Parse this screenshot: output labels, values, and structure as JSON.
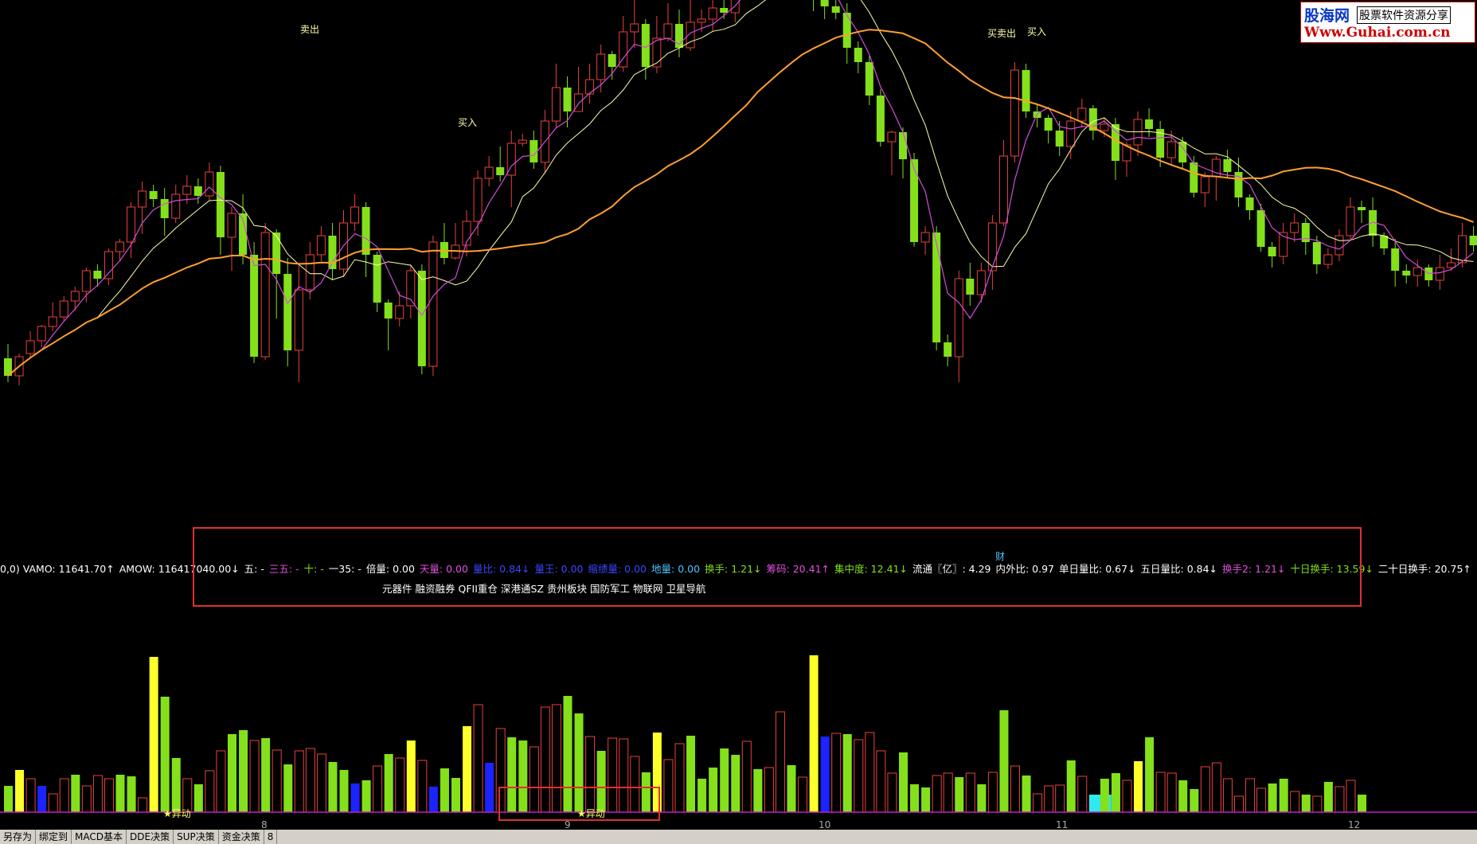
{
  "chart_data": {
    "type": "candlestick",
    "candles": [
      [
        -15,
        -26,
        -6,
        -30
      ],
      [
        -26,
        -14,
        -12,
        -32
      ],
      [
        -12,
        -4,
        2,
        -15
      ],
      [
        -4,
        5,
        6,
        -8
      ],
      [
        5,
        11,
        20,
        2
      ],
      [
        11,
        21,
        24,
        8
      ],
      [
        21,
        27,
        30,
        15
      ],
      [
        27,
        40,
        42,
        20
      ],
      [
        40,
        35,
        44,
        30
      ],
      [
        35,
        52,
        54,
        31
      ],
      [
        52,
        58,
        60,
        46
      ],
      [
        58,
        80,
        83,
        48
      ],
      [
        80,
        90,
        96,
        63
      ],
      [
        90,
        85,
        94,
        80
      ],
      [
        85,
        73,
        92,
        62
      ],
      [
        73,
        88,
        94,
        70
      ],
      [
        88,
        93,
        100,
        82
      ],
      [
        93,
        87,
        98,
        82
      ],
      [
        87,
        102,
        108,
        84
      ],
      [
        102,
        61,
        106,
        50
      ],
      [
        61,
        76,
        80,
        40
      ],
      [
        76,
        50,
        88,
        44
      ],
      [
        50,
        -14,
        58,
        -18
      ],
      [
        -14,
        64,
        70,
        -16
      ],
      [
        64,
        38,
        66,
        10
      ],
      [
        38,
        -10,
        48,
        -20
      ],
      [
        -10,
        28,
        45,
        -30
      ],
      [
        28,
        50,
        58,
        22
      ],
      [
        50,
        62,
        68,
        46
      ],
      [
        62,
        41,
        70,
        34
      ],
      [
        41,
        70,
        78,
        36
      ],
      [
        70,
        80,
        88,
        65
      ],
      [
        80,
        50,
        83,
        36
      ],
      [
        50,
        20,
        52,
        14
      ],
      [
        20,
        10,
        22,
        -10
      ],
      [
        10,
        18,
        27,
        5
      ],
      [
        18,
        40,
        44,
        10
      ],
      [
        40,
        -20,
        44,
        -25
      ],
      [
        -20,
        58,
        62,
        -26
      ],
      [
        58,
        48,
        70,
        44
      ],
      [
        48,
        56,
        70,
        47
      ],
      [
        56,
        71,
        78,
        49
      ],
      [
        71,
        98,
        103,
        62
      ],
      [
        98,
        105,
        112,
        93
      ],
      [
        105,
        100,
        118,
        96
      ],
      [
        100,
        120,
        128,
        80
      ],
      [
        120,
        122,
        126,
        118
      ],
      [
        122,
        108,
        128,
        104
      ],
      [
        108,
        134,
        141,
        101
      ],
      [
        134,
        155,
        170,
        130
      ],
      [
        155,
        140,
        162,
        130
      ],
      [
        140,
        151,
        168,
        142
      ],
      [
        151,
        160,
        170,
        145
      ],
      [
        160,
        176,
        182,
        152
      ],
      [
        176,
        168,
        178,
        160
      ],
      [
        168,
        190,
        200,
        165
      ],
      [
        190,
        195,
        210,
        180
      ],
      [
        195,
        168,
        198,
        160
      ],
      [
        168,
        186,
        200,
        164
      ],
      [
        186,
        195,
        208,
        184
      ],
      [
        195,
        180,
        204,
        174
      ],
      [
        180,
        196,
        214,
        178
      ],
      [
        196,
        198,
        204,
        190
      ],
      [
        198,
        205,
        214,
        190
      ],
      [
        205,
        202,
        212,
        198
      ],
      [
        202,
        220,
        226,
        196
      ],
      [
        220,
        232,
        238,
        214
      ],
      [
        232,
        228,
        236,
        224
      ],
      [
        228,
        243,
        250,
        225
      ],
      [
        243,
        236,
        250,
        232
      ],
      [
        236,
        229,
        240,
        222
      ],
      [
        229,
        233,
        238,
        224
      ],
      [
        233,
        213,
        236,
        203
      ],
      [
        213,
        206,
        216,
        198
      ],
      [
        206,
        202,
        210,
        198
      ],
      [
        202,
        180,
        208,
        170
      ],
      [
        180,
        171,
        184,
        164
      ],
      [
        171,
        150,
        175,
        144
      ],
      [
        150,
        121,
        154,
        118
      ],
      [
        121,
        127,
        128,
        100
      ],
      [
        127,
        110,
        130,
        98
      ],
      [
        110,
        58,
        114,
        55
      ],
      [
        58,
        64,
        68,
        50
      ],
      [
        64,
        -5,
        68,
        -10
      ],
      [
        -5,
        -14,
        0,
        -20
      ],
      [
        -14,
        35,
        40,
        -30
      ],
      [
        35,
        25,
        45,
        18
      ],
      [
        25,
        40,
        45,
        20
      ],
      [
        40,
        70,
        75,
        28
      ],
      [
        70,
        112,
        122,
        68
      ],
      [
        112,
        166,
        171,
        108
      ],
      [
        166,
        140,
        170,
        136
      ],
      [
        140,
        136,
        144,
        130
      ],
      [
        136,
        128,
        138,
        120
      ],
      [
        128,
        118,
        134,
        112
      ],
      [
        118,
        134,
        140,
        110
      ],
      [
        134,
        142,
        148,
        130
      ],
      [
        142,
        128,
        144,
        122
      ],
      [
        128,
        132,
        136,
        124
      ],
      [
        132,
        109,
        136,
        97
      ],
      [
        109,
        119,
        121,
        99
      ],
      [
        119,
        135,
        140,
        112
      ],
      [
        135,
        129,
        142,
        124
      ],
      [
        129,
        111,
        134,
        105
      ],
      [
        111,
        121,
        128,
        106
      ],
      [
        121,
        108,
        124,
        104
      ],
      [
        108,
        89,
        112,
        86
      ],
      [
        89,
        99,
        102,
        80
      ],
      [
        99,
        110,
        112,
        84
      ],
      [
        110,
        102,
        116,
        98
      ],
      [
        102,
        86,
        111,
        80
      ],
      [
        86,
        78,
        88,
        72
      ],
      [
        78,
        55,
        82,
        52
      ],
      [
        55,
        49,
        58,
        42
      ],
      [
        49,
        64,
        70,
        44
      ],
      [
        64,
        70,
        76,
        58
      ],
      [
        70,
        58,
        73,
        50
      ],
      [
        58,
        44,
        62,
        38
      ],
      [
        44,
        50,
        54,
        41
      ],
      [
        50,
        62,
        66,
        46
      ],
      [
        62,
        80,
        86,
        59
      ],
      [
        80,
        78,
        84,
        70
      ],
      [
        78,
        62,
        86,
        55
      ],
      [
        62,
        54,
        64,
        50
      ],
      [
        54,
        40,
        60,
        30
      ],
      [
        40,
        37,
        44,
        32
      ],
      [
        37,
        42,
        47,
        30
      ],
      [
        42,
        34,
        44,
        30
      ],
      [
        34,
        42,
        50,
        28
      ],
      [
        42,
        45,
        54,
        40
      ],
      [
        45,
        62,
        70,
        42
      ],
      [
        62,
        56,
        68,
        52
      ]
    ],
    "volume": [
      [
        33,
        "green"
      ],
      [
        53,
        "yellow"
      ],
      [
        42,
        "hollow"
      ],
      [
        33,
        "blue"
      ],
      [
        23,
        "hollow"
      ],
      [
        42,
        "hollow"
      ],
      [
        47,
        "green"
      ],
      [
        33,
        "hollow"
      ],
      [
        46,
        "hollow"
      ],
      [
        42,
        "hollow"
      ],
      [
        47,
        "green"
      ],
      [
        45,
        "green"
      ],
      [
        18,
        "hollow"
      ],
      [
        195,
        "yellow"
      ],
      [
        145,
        "green"
      ],
      [
        68,
        "green"
      ],
      [
        42,
        "hollow"
      ],
      [
        35,
        "green"
      ],
      [
        52,
        "hollow"
      ],
      [
        77,
        "hollow"
      ],
      [
        98,
        "green"
      ],
      [
        103,
        "green"
      ],
      [
        90,
        "hollow"
      ],
      [
        93,
        "green"
      ],
      [
        78,
        "hollow"
      ],
      [
        60,
        "green"
      ],
      [
        77,
        "hollow"
      ],
      [
        80,
        "hollow"
      ],
      [
        73,
        "hollow"
      ],
      [
        63,
        "green"
      ],
      [
        53,
        "green"
      ],
      [
        36,
        "blue"
      ],
      [
        40,
        "green"
      ],
      [
        58,
        "hollow"
      ],
      [
        73,
        "green"
      ],
      [
        68,
        "hollow"
      ],
      [
        90,
        "yellow"
      ],
      [
        65,
        "hollow"
      ],
      [
        32,
        "blue"
      ],
      [
        55,
        "green"
      ],
      [
        43,
        "green"
      ],
      [
        108,
        "yellow"
      ],
      [
        135,
        "hollow"
      ],
      [
        62,
        "blue"
      ],
      [
        105,
        "hollow"
      ],
      [
        94,
        "green"
      ],
      [
        90,
        "green"
      ],
      [
        82,
        "hollow"
      ],
      [
        132,
        "hollow"
      ],
      [
        135,
        "hollow"
      ],
      [
        146,
        "green"
      ],
      [
        124,
        "green"
      ],
      [
        95,
        "hollow"
      ],
      [
        77,
        "green"
      ],
      [
        93,
        "hollow"
      ],
      [
        92,
        "hollow"
      ],
      [
        70,
        "hollow"
      ],
      [
        50,
        "green"
      ],
      [
        100,
        "yellow"
      ],
      [
        66,
        "hollow"
      ],
      [
        86,
        "hollow"
      ],
      [
        96,
        "green"
      ],
      [
        42,
        "green"
      ],
      [
        56,
        "green"
      ],
      [
        80,
        "green"
      ],
      [
        72,
        "green"
      ],
      [
        89,
        "hollow"
      ],
      [
        54,
        "green"
      ],
      [
        56,
        "hollow"
      ],
      [
        126,
        "hollow"
      ],
      [
        59,
        "green"
      ],
      [
        44,
        "hollow"
      ],
      [
        197,
        "yellow"
      ],
      [
        95,
        "blue"
      ],
      [
        99,
        "hollow"
      ],
      [
        98,
        "green"
      ],
      [
        91,
        "hollow"
      ],
      [
        100,
        "hollow"
      ],
      [
        77,
        "hollow"
      ],
      [
        49,
        "hollow"
      ],
      [
        75,
        "green"
      ],
      [
        35,
        "green"
      ],
      [
        31,
        "green"
      ],
      [
        46,
        "hollow"
      ],
      [
        49,
        "hollow"
      ],
      [
        44,
        "green"
      ],
      [
        49,
        "hollow"
      ],
      [
        35,
        "green"
      ],
      [
        50,
        "hollow"
      ],
      [
        128,
        "green"
      ],
      [
        58,
        "hollow"
      ],
      [
        46,
        "green"
      ],
      [
        23,
        "hollow"
      ],
      [
        33,
        "hollow"
      ],
      [
        34,
        "hollow"
      ],
      [
        65,
        "green"
      ],
      [
        45,
        "hollow"
      ],
      [
        22,
        "cyan"
      ],
      [
        42,
        "green"
      ],
      [
        49,
        "green"
      ],
      [
        40,
        "hollow"
      ],
      [
        64,
        "yellow"
      ],
      [
        94,
        "green"
      ],
      [
        50,
        "hollow"
      ],
      [
        49,
        "hollow"
      ],
      [
        40,
        "green"
      ],
      [
        29,
        "green"
      ],
      [
        57,
        "hollow"
      ],
      [
        62,
        "hollow"
      ],
      [
        42,
        "hollow"
      ],
      [
        20,
        "hollow"
      ],
      [
        42,
        "hollow"
      ],
      [
        30,
        "hollow"
      ],
      [
        36,
        "green"
      ],
      [
        42,
        "green"
      ],
      [
        26,
        "hollow"
      ],
      [
        22,
        "green"
      ],
      [
        20,
        "hollow"
      ],
      [
        38,
        "green"
      ],
      [
        32,
        "hollow"
      ],
      [
        40,
        "hollow"
      ],
      [
        22,
        "green"
      ]
    ],
    "volume_colors": {
      "hollow": "#e8423c",
      "green": "#84e01a",
      "yellow": "#ffff2a",
      "blue": "#1b23ff",
      "cyan": "#2fe9ef"
    },
    "price_colors": {
      "up": "#e8423c",
      "down": "#84e01a",
      "ma_orange": "#ff9f30",
      "ma_magenta": "#d14ddb",
      "ma_white": "#ffffa8"
    },
    "x_ticks": [
      "8",
      "9",
      "10",
      "11",
      "12"
    ]
  },
  "annotations": {
    "sell1": "卖出",
    "buy1": "买入",
    "buy_sell2": "买卖出",
    "buy2": "买入",
    "cai": "财",
    "yidong": "★异动"
  },
  "indicators": [
    {
      "text": "0,0) VAMO: 11641.70↑",
      "color": "#ffffff"
    },
    {
      "text": "AMOW: 116417040.00↓",
      "color": "#ffffff"
    },
    {
      "text": "五: -",
      "color": "#ffffff"
    },
    {
      "text": "三五: -",
      "color": "#e04fe0"
    },
    {
      "text": "十: -",
      "color": "#84e01a"
    },
    {
      "text": "一35: -",
      "color": "#ffffff"
    },
    {
      "text": "倍量: 0.00",
      "color": "#ffffff"
    },
    {
      "text": "天量: 0.00",
      "color": "#e04fe0"
    },
    {
      "text": "量比: 0.84↓",
      "color": "#3a46ff"
    },
    {
      "text": "量王: 0.00",
      "color": "#3a46ff"
    },
    {
      "text": "缩绩量: 0.00",
      "color": "#3a46ff"
    },
    {
      "text": "地量: 0.00",
      "color": "#4fc3ff"
    },
    {
      "text": "换手: 1.21↓",
      "color": "#84e01a"
    },
    {
      "text": "筹码: 20.41↑",
      "color": "#e04fe0"
    },
    {
      "text": "集中度: 12.41↓",
      "color": "#84e01a"
    },
    {
      "text": "流通〖亿〗: 4.29",
      "color": "#ffffff"
    },
    {
      "text": "内外比: 0.97",
      "color": "#ffffff"
    },
    {
      "text": "单日量比: 0.67↓",
      "color": "#ffffff"
    },
    {
      "text": "五日量比: 0.84↓",
      "color": "#ffffff"
    },
    {
      "text": "换手2: 1.21↓",
      "color": "#e04fe0"
    },
    {
      "text": "十日换手: 13.59↓",
      "color": "#84e01a"
    },
    {
      "text": "二十日换手: 20.75↑",
      "color": "#ffffff"
    }
  ],
  "concepts": [
    "元器件",
    "融资融券",
    "QFII重仓",
    "深港通SZ",
    "贵州板块",
    "国防军工",
    "物联网",
    "卫星导航"
  ],
  "statusbar": [
    "另存为",
    "绑定到",
    "MACD基本",
    "DDE决策",
    "SUP决策",
    "资金决策",
    "8"
  ],
  "logo": {
    "line1": "股海网",
    "line1b": "股票软件资源分享",
    "line2": "Www.Guhai.com.cn"
  }
}
